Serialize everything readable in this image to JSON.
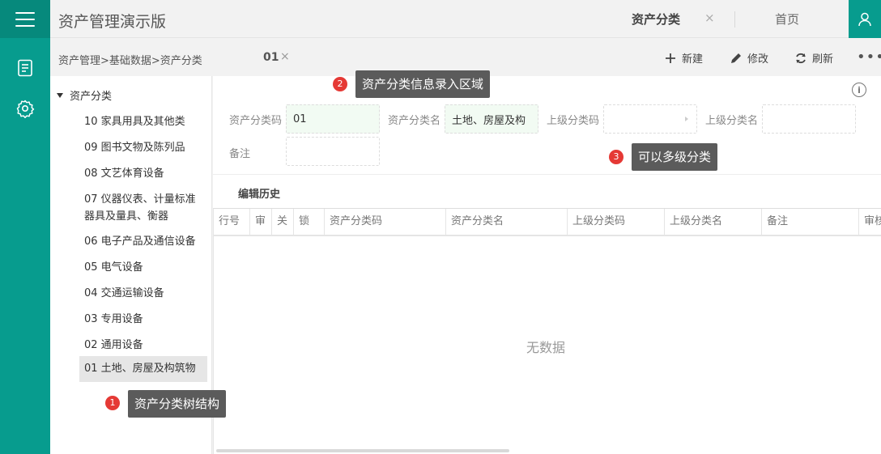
{
  "app": {
    "title": "资产管理演示版"
  },
  "tabs": {
    "active": "资产分类",
    "close": "×",
    "home": "首页"
  },
  "breadcrumb": "资产管理>基础数据>资产分类",
  "record_tab": {
    "label": "01",
    "close": "×"
  },
  "toolbar": {
    "new": "新建",
    "edit": "修改",
    "refresh": "刷新",
    "more": "•••"
  },
  "tree": {
    "root": "资产分类",
    "items": [
      "10 家具用具及其他类",
      "09 图书文物及陈列品",
      "08 文艺体育设备",
      "07 仪器仪表、计量标准器具及量具、衡器",
      "06 电子产品及通信设备",
      "05 电气设备",
      "04 交通运输设备",
      "03 专用设备",
      "02 通用设备",
      "01 土地、房屋及构筑物"
    ],
    "selected_index": 9
  },
  "form": {
    "code_label": "资产分类码",
    "code_value": "01",
    "name_label": "资产分类名",
    "name_value": "土地、房屋及构",
    "parent_code_label": "上级分类码",
    "parent_name_label": "上级分类名",
    "remark_label": "备注",
    "info": "i"
  },
  "history": {
    "title": "编辑历史",
    "columns": [
      "行号",
      "审",
      "关",
      "锁",
      "资产分类码",
      "资产分类名",
      "上级分类码",
      "上级分类名",
      "备注",
      "审核"
    ],
    "empty_text": "无数据"
  },
  "tips": [
    {
      "num": "1",
      "text": "资产分类树结构"
    },
    {
      "num": "2",
      "text": "资产分类信息录入区域"
    },
    {
      "num": "3",
      "text": "可以多级分类"
    }
  ],
  "colors": {
    "brand": "#079c8e",
    "tip_bg": "#5b5b5b",
    "tip_dot": "#e53935"
  }
}
